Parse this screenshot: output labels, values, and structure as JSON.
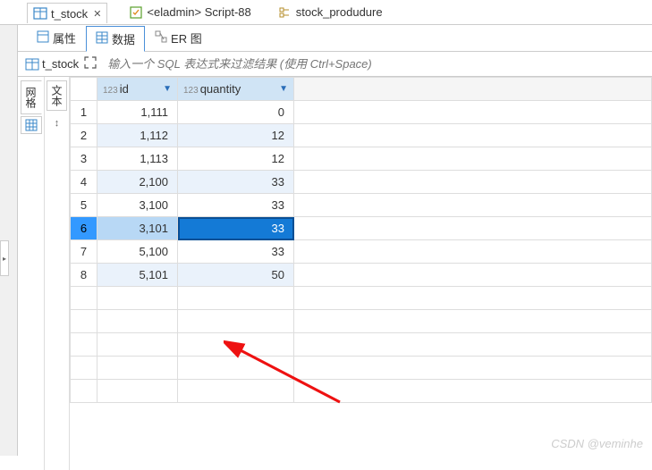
{
  "topTabs": [
    {
      "label": "t_stock",
      "active": true,
      "hasClose": true,
      "icon": "table"
    },
    {
      "label": "<eladmin> Script-88",
      "active": false,
      "hasClose": false,
      "icon": "sql"
    },
    {
      "label": "stock_produdure",
      "active": false,
      "hasClose": false,
      "icon": "proc"
    }
  ],
  "subTabs": [
    {
      "label": "属性",
      "icon": "props",
      "active": false
    },
    {
      "label": "数据",
      "icon": "data",
      "active": true
    },
    {
      "label": "ER 图",
      "icon": "er",
      "active": false
    }
  ],
  "breadcrumb": {
    "table": "t_stock"
  },
  "filter": {
    "placeholder": "输入一个 SQL 表达式来过滤结果 (使用 Ctrl+Space)"
  },
  "sideTabs": {
    "t1": "网格",
    "t2": "文本"
  },
  "columns": {
    "id": "id",
    "quantity": "quantity",
    "typePrefix": "123"
  },
  "chart_data": {
    "type": "table",
    "columns": [
      "id",
      "quantity"
    ],
    "rows": [
      {
        "n": 1,
        "id": "1,111",
        "quantity": "0"
      },
      {
        "n": 2,
        "id": "1,112",
        "quantity": "12"
      },
      {
        "n": 3,
        "id": "1,113",
        "quantity": "12"
      },
      {
        "n": 4,
        "id": "2,100",
        "quantity": "33"
      },
      {
        "n": 5,
        "id": "3,100",
        "quantity": "33"
      },
      {
        "n": 6,
        "id": "3,101",
        "quantity": "33"
      },
      {
        "n": 7,
        "id": "5,100",
        "quantity": "33"
      },
      {
        "n": 8,
        "id": "5,101",
        "quantity": "50"
      }
    ],
    "selectedRow": 6,
    "selectedCol": "quantity"
  },
  "watermark": "CSDN @veminhe"
}
